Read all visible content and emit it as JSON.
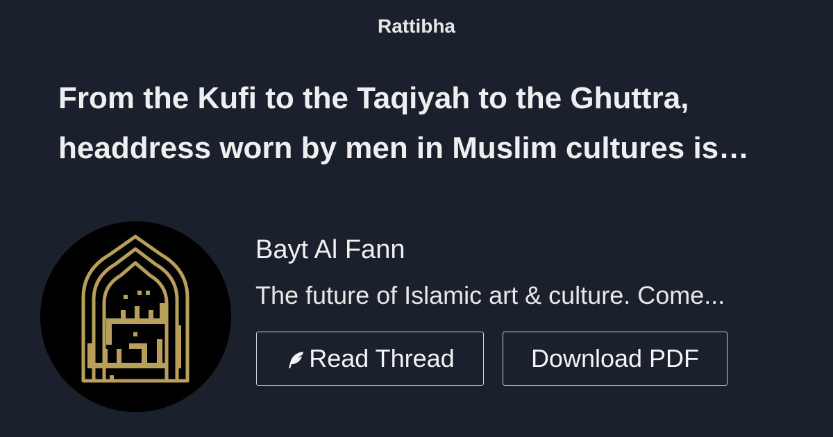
{
  "brand": "Rattibha",
  "headline": "From the Kufi to the Taqiyah to the Ghuttra, headdress worn by men in Muslim cultures is…",
  "author": {
    "name": "Bayt Al Fann",
    "bio": "The future of Islamic art & culture. Come..."
  },
  "actions": {
    "read_label": "Read Thread",
    "pdf_label": "Download PDF",
    "read_icon": "feather-icon"
  },
  "colors": {
    "background": "#1a202c",
    "avatar_background": "#000000",
    "logo_gold": "#b9a05a"
  },
  "avatar": {
    "logo_text": "بيت الفن"
  }
}
